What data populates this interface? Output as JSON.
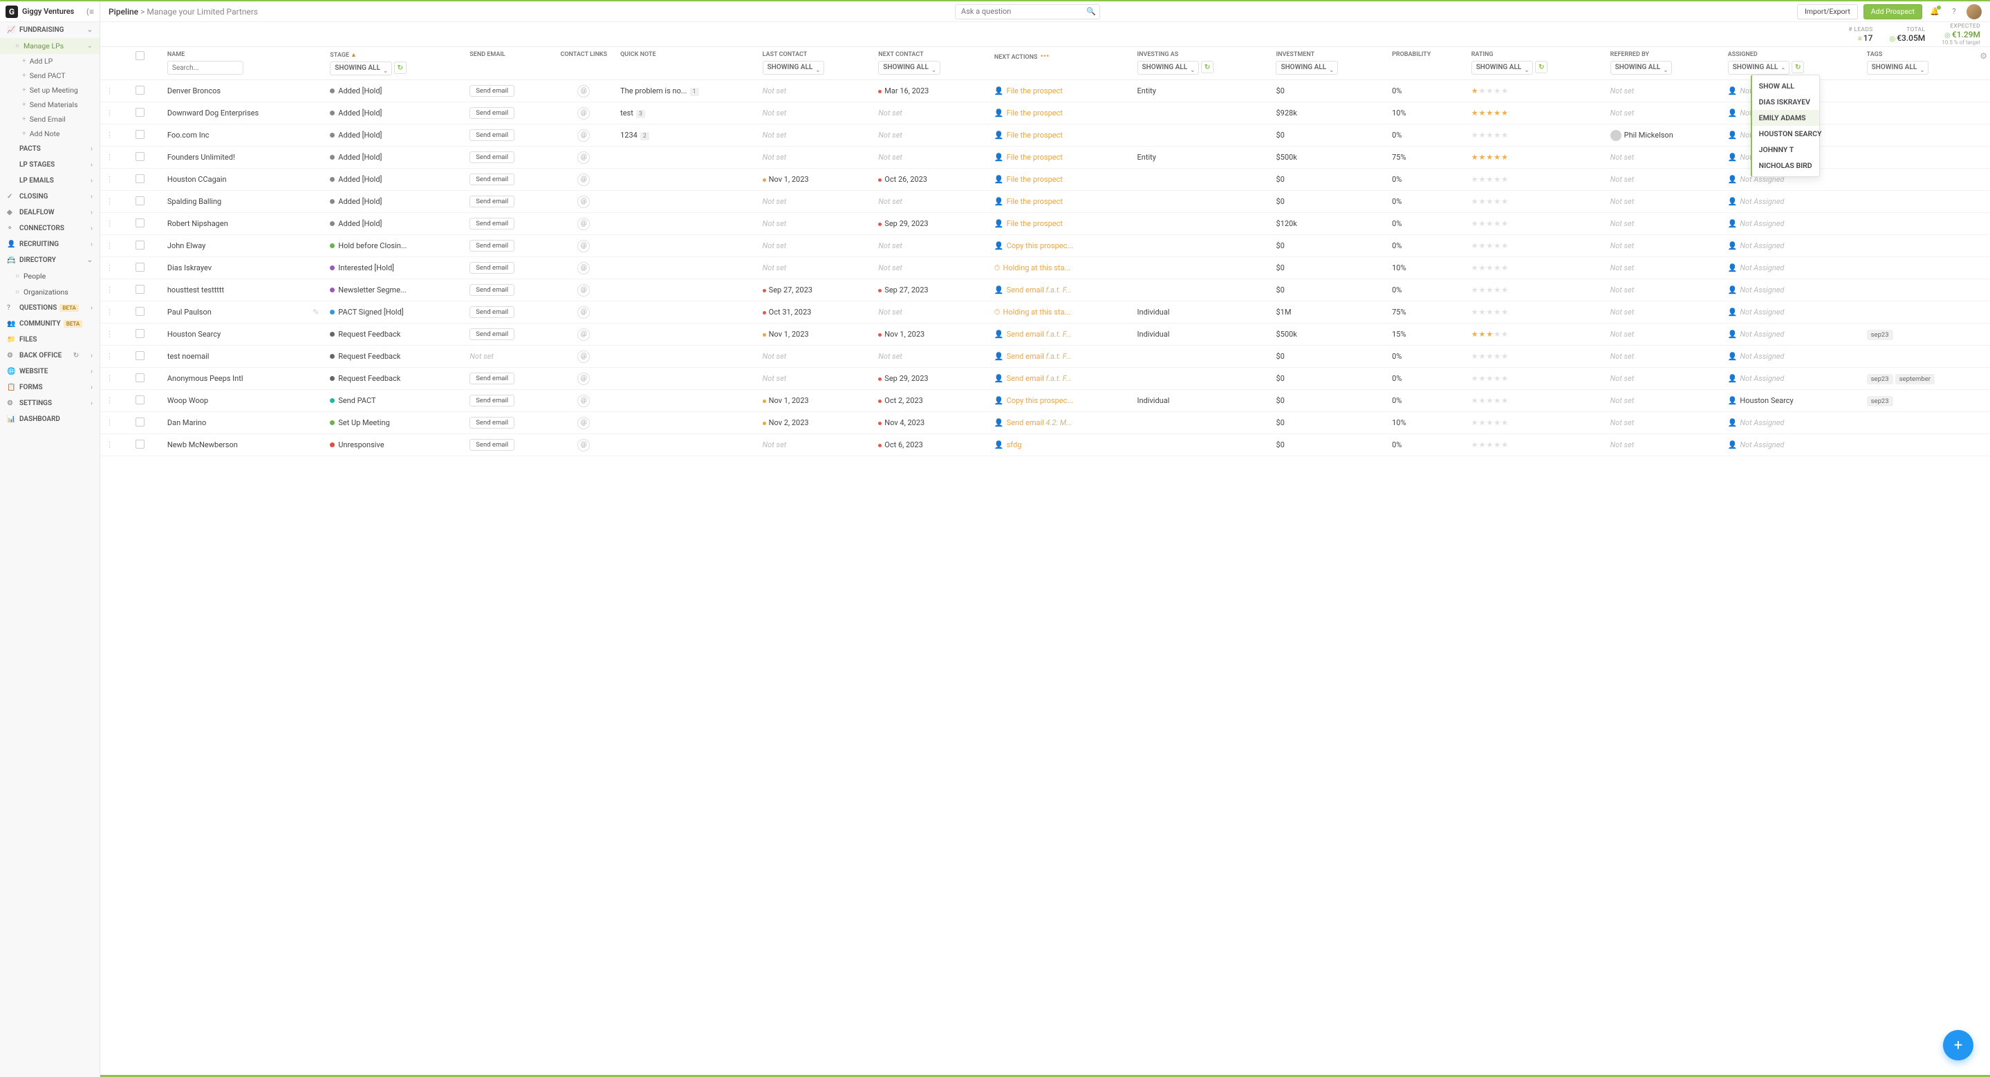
{
  "workspace": "Giggy Ventures",
  "breadcrumb": {
    "root": "Pipeline",
    "page": "Manage your Limited Partners"
  },
  "search": {
    "placeholder": "Ask a question"
  },
  "topButtons": {
    "importExport": "Import/Export",
    "addProspect": "Add Prospect"
  },
  "stats": {
    "leads": {
      "label": "# LEADS",
      "value": "17"
    },
    "total": {
      "label": "TOTAL",
      "value": "€3.05M"
    },
    "expected": {
      "label": "EXPECTED",
      "value": "€1.29M",
      "sub": "10.5 % of target"
    }
  },
  "sidebar": {
    "sections": [
      {
        "label": "FUNDRAISING",
        "icon": "📈",
        "expandable": true,
        "open": true,
        "items": [
          {
            "label": "Manage LPs",
            "active": true,
            "subitems": [
              {
                "label": "Add LP"
              },
              {
                "label": "Send PACT"
              },
              {
                "label": "Set up Meeting"
              },
              {
                "label": "Send Materials"
              },
              {
                "label": "Send Email"
              },
              {
                "label": "Add Note"
              }
            ]
          }
        ]
      },
      {
        "label": "PACTs",
        "chev": true
      },
      {
        "label": "LP Stages",
        "chev": true
      },
      {
        "label": "LP Emails",
        "chev": true
      },
      {
        "label": "CLOSING",
        "icon": "✓",
        "chev": true
      },
      {
        "label": "DEALFLOW",
        "icon": "◆",
        "chev": true
      },
      {
        "label": "CONNECTORS",
        "icon": "⚬",
        "chev": true
      },
      {
        "label": "RECRUITING",
        "icon": "👤",
        "chev": true
      },
      {
        "label": "DIRECTORY",
        "icon": "📇",
        "expandable": true,
        "open": true,
        "items": [
          {
            "label": "People"
          },
          {
            "label": "Organizations"
          }
        ]
      },
      {
        "label": "QUESTIONS",
        "icon": "?",
        "beta": true,
        "chev": true
      },
      {
        "label": "COMMUNITY",
        "icon": "👥",
        "beta": true
      },
      {
        "label": "FILES",
        "icon": "📁"
      },
      {
        "label": "BACK OFFICE",
        "icon": "⚙",
        "chev": true,
        "extra": "↻"
      },
      {
        "label": "WEBSITE",
        "icon": "🌐",
        "chev": true
      },
      {
        "label": "FORMS",
        "icon": "📋",
        "chev": true
      },
      {
        "label": "SETTINGS",
        "icon": "⚙",
        "chev": true
      },
      {
        "label": "DASHBOARD",
        "icon": "📊"
      }
    ]
  },
  "columns": {
    "name": "NAME",
    "stage": "STAGE",
    "sendEmail": "SEND EMAIL",
    "contactLinks": "CONTACT LINKS",
    "quickNote": "QUICK NOTE",
    "lastContact": "LAST CONTACT",
    "nextContact": "NEXT CONTACT",
    "nextActions": "NEXT ACTIONS",
    "investingAs": "INVESTING AS",
    "investment": "INVESTMENT",
    "probability": "PROBABILITY",
    "rating": "RATING",
    "referredBy": "REFERRED BY",
    "assigned": "ASSIGNED",
    "tags": "TAGS"
  },
  "filterLabel": "Showing All",
  "nameSearchPlaceholder": "Search...",
  "sendEmailBtn": "Send email",
  "notSet": "Not set",
  "notAssigned": "Not Assigned",
  "assignedDropdown": {
    "options": [
      "Show All",
      "Dias Iskrayev",
      "Emily Adams",
      "Houston Searcy",
      "Johnny T",
      "Nicholas Bird"
    ],
    "selected": "Emily Adams"
  },
  "rows": [
    {
      "name": "Denver Broncos",
      "stage": "Added [Hold]",
      "stageColor": "#888",
      "sendEmail": true,
      "note": "The problem is no...",
      "noteCount": "1",
      "lastContact": "",
      "nextContact": "Mar 16, 2023",
      "nextDot": "red",
      "action": "File the prospect",
      "actionIcon": "user",
      "investingAs": "Entity",
      "investment": "$0",
      "probability": "0%",
      "rating": 1,
      "referred": "",
      "assigned": "",
      "tags": []
    },
    {
      "name": "Downward Dog Enterprises",
      "stage": "Added [Hold]",
      "stageColor": "#888",
      "sendEmail": true,
      "note": "test",
      "noteCount": "3",
      "lastContact": "",
      "nextContact": "",
      "action": "File the prospect",
      "actionIcon": "user",
      "investingAs": "",
      "investment": "$928k",
      "probability": "10%",
      "rating": 5,
      "referred": "",
      "assigned": "",
      "tags": []
    },
    {
      "name": "Foo.com Inc",
      "stage": "Added [Hold]",
      "stageColor": "#888",
      "sendEmail": true,
      "note": "1234",
      "noteCount": "2",
      "lastContact": "",
      "nextContact": "",
      "action": "File the prospect",
      "actionIcon": "user",
      "investingAs": "",
      "investment": "$0",
      "probability": "0%",
      "rating": 0,
      "referred": "Phil Mickelson",
      "referredAv": true,
      "assigned": "",
      "tags": []
    },
    {
      "name": "Founders Unlimited!",
      "stage": "Added [Hold]",
      "stageColor": "#888",
      "sendEmail": true,
      "note": "",
      "lastContact": "",
      "nextContact": "",
      "action": "File the prospect",
      "actionIcon": "user",
      "investingAs": "Entity",
      "investment": "$500k",
      "probability": "75%",
      "rating": 5,
      "referred": "",
      "assigned": "",
      "tags": []
    },
    {
      "name": "Houston CCagain",
      "stage": "Added [Hold]",
      "stageColor": "#888",
      "sendEmail": true,
      "note": "",
      "lastContact": "Nov 1, 2023",
      "lastDot": "orange",
      "nextContact": "Oct 26, 2023",
      "nextDot": "red",
      "action": "File the prospect",
      "actionIcon": "user",
      "investingAs": "",
      "investment": "$0",
      "probability": "0%",
      "rating": 0,
      "referred": "",
      "assigned": "",
      "tags": []
    },
    {
      "name": "Spalding Balling",
      "stage": "Added [Hold]",
      "stageColor": "#888",
      "sendEmail": true,
      "note": "",
      "lastContact": "",
      "nextContact": "",
      "action": "File the prospect",
      "actionIcon": "user",
      "investingAs": "",
      "investment": "$0",
      "probability": "0%",
      "rating": 0,
      "referred": "",
      "assigned": "",
      "tags": []
    },
    {
      "name": "Robert Nipshagen",
      "stage": "Added [Hold]",
      "stageColor": "#888",
      "sendEmail": true,
      "note": "",
      "lastContact": "",
      "nextContact": "Sep 29, 2023",
      "nextDot": "red",
      "action": "File the prospect",
      "actionIcon": "user",
      "investingAs": "",
      "investment": "$120k",
      "probability": "0%",
      "rating": 0,
      "referred": "",
      "assigned": "",
      "tags": []
    },
    {
      "name": "John Elway",
      "stage": "Hold before Closin...",
      "stageColor": "#6ab04c",
      "sendEmail": true,
      "note": "",
      "lastContact": "",
      "nextContact": "",
      "action": "Copy this prospec...",
      "actionIcon": "user",
      "investingAs": "",
      "investment": "$0",
      "probability": "0%",
      "rating": 0,
      "referred": "",
      "assigned": "",
      "tags": []
    },
    {
      "name": "Dias Iskrayev",
      "stage": "Interested [Hold]",
      "stageColor": "#9b59b6",
      "sendEmail": true,
      "note": "",
      "lastContact": "",
      "nextContact": "",
      "action": "Holding at this sta...",
      "actionIcon": "clock",
      "investingAs": "",
      "investment": "$0",
      "probability": "10%",
      "rating": 0,
      "referred": "",
      "assigned": "",
      "tags": []
    },
    {
      "name": "housttest testtttt",
      "stage": "Newsletter Segme...",
      "stageColor": "#9b59b6",
      "sendEmail": true,
      "note": "",
      "lastContact": "Sep 27, 2023",
      "lastDot": "red",
      "nextContact": "Sep 27, 2023",
      "nextDot": "red",
      "action": "Send email",
      "actionSub": "f.a.t. F...",
      "actionIcon": "user",
      "investingAs": "",
      "investment": "$0",
      "probability": "0%",
      "rating": 0,
      "referred": "",
      "assigned": "",
      "tags": []
    },
    {
      "name": "Paul Paulson",
      "stage": "PACT Signed [Hold]",
      "stageColor": "#3498db",
      "sendEmail": true,
      "note": "",
      "lastContact": "Oct 31, 2023",
      "lastDot": "red",
      "nextContact": "",
      "action": "Holding at this sta...",
      "actionIcon": "clock",
      "investingAs": "Individual",
      "investment": "$1M",
      "probability": "75%",
      "rating": 0,
      "referred": "",
      "assigned": "",
      "tags": [],
      "editIcon": true
    },
    {
      "name": "Houston Searcy",
      "stage": "Request Feedback",
      "stageColor": "#666",
      "sendEmail": true,
      "note": "",
      "lastContact": "Nov 1, 2023",
      "lastDot": "orange",
      "nextContact": "Nov 1, 2023",
      "nextDot": "red",
      "action": "Send email",
      "actionSub": "f.a.t. F...",
      "actionIcon": "user",
      "investingAs": "Individual",
      "investment": "$500k",
      "probability": "15%",
      "rating": 3,
      "referred": "",
      "assigned": "",
      "tags": [
        "sep23"
      ]
    },
    {
      "name": "test noemail",
      "stage": "Request Feedback",
      "stageColor": "#666",
      "sendEmail": false,
      "note": "",
      "lastContact": "",
      "nextContact": "",
      "action": "Send email",
      "actionSub": "f.a.t. F...",
      "actionIcon": "user",
      "investingAs": "",
      "investment": "$0",
      "probability": "0%",
      "rating": 0,
      "referred": "",
      "assigned": "",
      "tags": []
    },
    {
      "name": "Anonymous Peeps Intl",
      "stage": "Request Feedback",
      "stageColor": "#666",
      "sendEmail": true,
      "note": "",
      "lastContact": "",
      "nextContact": "Sep 29, 2023",
      "nextDot": "red",
      "action": "Send email",
      "actionSub": "f.a.t. F...",
      "actionIcon": "user",
      "investingAs": "",
      "investment": "$0",
      "probability": "0%",
      "rating": 0,
      "referred": "",
      "assigned": "",
      "tags": [
        "sep23",
        "september"
      ]
    },
    {
      "name": "Woop Woop",
      "stage": "Send PACT",
      "stageColor": "#1abc9c",
      "sendEmail": true,
      "note": "",
      "lastContact": "Nov 1, 2023",
      "lastDot": "orange",
      "nextContact": "Oct 2, 2023",
      "nextDot": "red",
      "action": "Copy this prospec...",
      "actionIcon": "user",
      "investingAs": "Individual",
      "investment": "$0",
      "probability": "0%",
      "rating": 0,
      "referred": "",
      "assigned": "Houston Searcy",
      "assignedAv": true,
      "tags": [
        "sep23"
      ]
    },
    {
      "name": "Dan Marino",
      "stage": "Set Up Meeting",
      "stageColor": "#6ab04c",
      "sendEmail": true,
      "note": "",
      "lastContact": "Nov 2, 2023",
      "lastDot": "orange",
      "nextContact": "Nov 4, 2023",
      "nextDot": "red",
      "action": "Send email",
      "actionSub": "4.2: M...",
      "actionIcon": "user",
      "investingAs": "",
      "investment": "$0",
      "probability": "10%",
      "rating": 0,
      "referred": "",
      "assigned": "",
      "tags": []
    },
    {
      "name": "Newb McNewberson",
      "stage": "Unresponsive",
      "stageColor": "#e74c3c",
      "sendEmail": true,
      "note": "",
      "lastContact": "",
      "nextContact": "Oct 6, 2023",
      "nextDot": "red",
      "action": "sfdg",
      "actionIcon": "user",
      "investingAs": "",
      "investment": "$0",
      "probability": "0%",
      "rating": 0,
      "referred": "",
      "assigned": "",
      "tags": []
    }
  ]
}
